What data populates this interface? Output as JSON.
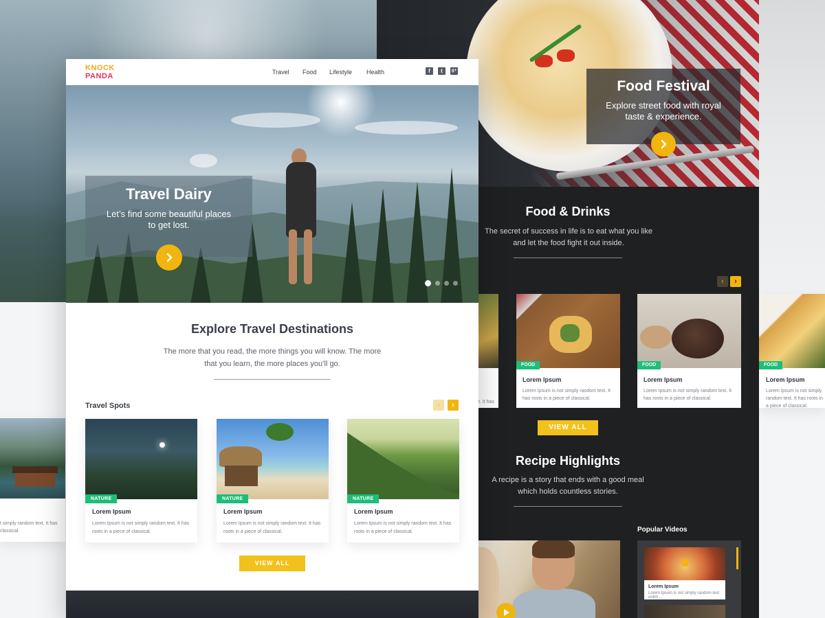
{
  "travel": {
    "logo": {
      "line1": "KNOCK",
      "line2": "PANDA"
    },
    "nav": [
      "Travel",
      "Food",
      "Lifestyle",
      "Health"
    ],
    "social": [
      {
        "icon": "facebook-icon",
        "glyph": "f"
      },
      {
        "icon": "twitter-icon",
        "glyph": "t"
      },
      {
        "icon": "google-plus-icon",
        "glyph": "g+"
      }
    ],
    "hero": {
      "title": "Travel Dairy",
      "subtitle": "Let’s find some beautiful places to get lost.",
      "slides": 4,
      "active_slide": 1
    },
    "explore": {
      "title": "Explore Travel Destinations",
      "text": "The more that you read, the more things you will know. The more that you learn, the more places you’ll go."
    },
    "spots": {
      "title": "Travel Spots",
      "cards": [
        {
          "tag": "NATURE",
          "title": "Lorem Ipsum",
          "text": "Lorem Ipsum is not simply random text. It has roots in a piece of classical."
        },
        {
          "tag": "NATURE",
          "title": "Lorem Ipsum",
          "text": "Lorem Ipsum is not simply random text. It has roots in a piece of classical."
        },
        {
          "tag": "NATURE",
          "title": "Lorem Ipsum",
          "text": "Lorem Ipsum is not simply random text. It has roots in a piece of classical."
        }
      ],
      "view_all": "VIEW ALL"
    },
    "left_partial": {
      "text": "t simply random text. It has classical."
    }
  },
  "food": {
    "hero": {
      "title": "Food Festival",
      "subtitle": "Explore street food with royal taste & experience."
    },
    "drinks": {
      "title": "Food & Drinks",
      "text": "The secret of success in life is to eat what you like and let the food fight it out inside."
    },
    "cards": [
      {
        "tag": "FOOD",
        "title": "Lorem Ipsum",
        "text": "Lorem Ipsum is not simply random text. It has roots in a piece of classical."
      },
      {
        "tag": "FOOD",
        "title": "Lorem Ipsum",
        "text": "Lorem Ipsum is not simply random text. It has roots in a piece of classical."
      }
    ],
    "left_partial_text": "t. It has",
    "right_partial": {
      "tag": "FOOD",
      "title": "Lorem Ipsum",
      "text": "Lorem Ipsum is not simply random text. It has roots in a piece of classical."
    },
    "view_all": "VIEW ALL",
    "recipe": {
      "title": "Recipe Highlights",
      "text": "A recipe is a story that ends with a good meal which holds countless stories."
    },
    "popular": {
      "title": "Popular Videos",
      "item_title": "Lorem Ipsum",
      "item_text": "Lorem Ipsum is not simply random text unlim..."
    }
  },
  "colors": {
    "accent": "#f2b50f",
    "tag_green": "#1ebd79",
    "dark_bg": "#1f2022"
  }
}
